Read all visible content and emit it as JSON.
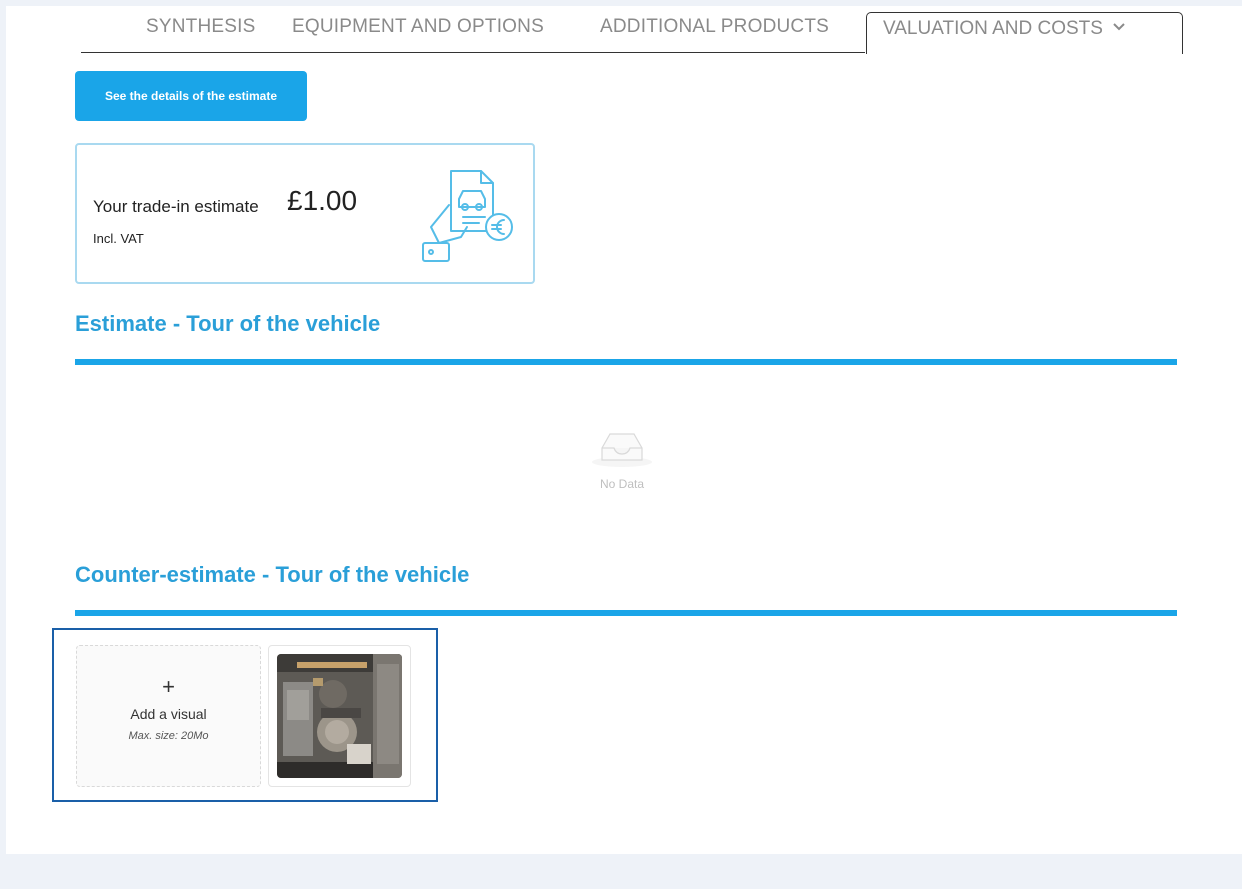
{
  "tabs": [
    {
      "label": "SYNTHESIS"
    },
    {
      "label": "EQUIPMENT AND OPTIONS"
    },
    {
      "label": "ADDITIONAL PRODUCTS"
    },
    {
      "label": "VALUATION AND COSTS"
    }
  ],
  "details_button": "See the details of the estimate",
  "estimate": {
    "label": "Your trade-in estimate",
    "value": "£1.00",
    "vat_note": "Incl. VAT",
    "illustration_icon": "car-document-euro-icon"
  },
  "sections": {
    "estimate_tour": {
      "title": "Estimate - Tour of the vehicle",
      "empty_icon": "inbox-icon",
      "empty_text": "No Data"
    },
    "counter_tour": {
      "title": "Counter-estimate - Tour of the vehicle"
    }
  },
  "upload": {
    "plus": "+",
    "label": "Add a visual",
    "hint": "Max. size: 20Mo"
  },
  "colors": {
    "accent": "#1aa5e8",
    "title": "#2a9fd8",
    "card_border": "#a9d9f0",
    "focus_border": "#1a5fa8"
  }
}
